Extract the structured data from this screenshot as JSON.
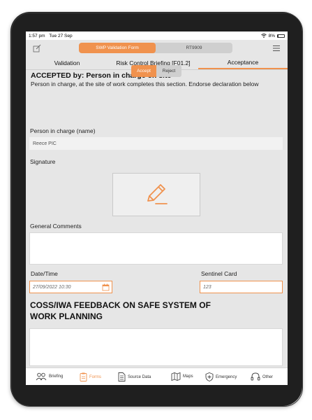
{
  "status": {
    "time": "1:57 pm",
    "date": "Tue 27 Sep",
    "battery": "8%"
  },
  "header": {
    "segments": [
      "SWP Validation Form",
      "RT9909"
    ],
    "active_segment": 0
  },
  "tabs": [
    {
      "label": "Validation"
    },
    {
      "label": "Risk Control Briefing [F01.2]"
    },
    {
      "label": "Acceptance"
    }
  ],
  "section": {
    "title": "ACCEPTED by: Person in charge on site",
    "description": "Person in charge, at the site of work completes this section. Endorse declaration below"
  },
  "decision": {
    "accept": "Accept",
    "reject": "Reject",
    "selected": "Accept"
  },
  "person": {
    "label": "Person in charge (name)",
    "value": "Reece PIC"
  },
  "signature": {
    "label": "Signature"
  },
  "comments": {
    "label": "General Comments",
    "value": ""
  },
  "datetime": {
    "label": "Date/Time",
    "value": "27/09/2022 10:30"
  },
  "sentinel": {
    "label": "Sentinel Card",
    "value": "123"
  },
  "feedback": {
    "title": "COSS/IWA FEEDBACK ON SAFE SYSTEM OF WORK PLANNING"
  },
  "nav": [
    {
      "label": "Briefing",
      "icon": "people-icon"
    },
    {
      "label": "Forms",
      "icon": "clipboard-icon"
    },
    {
      "label": "Source Data",
      "icon": "document-icon"
    },
    {
      "label": "Maps",
      "icon": "map-icon"
    },
    {
      "label": "Emergency",
      "icon": "shield-plus-icon"
    },
    {
      "label": "Other",
      "icon": "headset-icon"
    }
  ],
  "colors": {
    "accent": "#f0924e",
    "background": "#e6e6e6",
    "device": "#1f1f1f"
  }
}
